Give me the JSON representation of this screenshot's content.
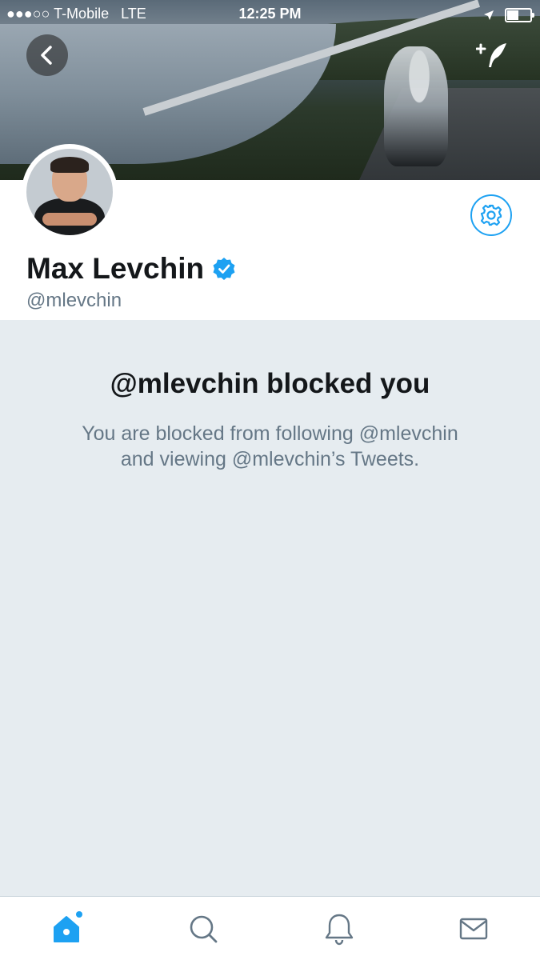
{
  "status_bar": {
    "signal": "●●●○○",
    "carrier": "T-Mobile",
    "network": "LTE",
    "time": "12:25 PM"
  },
  "profile": {
    "display_name": "Max Levchin",
    "handle": "@mlevchin",
    "verified": true
  },
  "blocked": {
    "title": "@mlevchin blocked you",
    "line1": "You are blocked from following @mlevchin",
    "line2": "and viewing @mlevchin’s Tweets."
  },
  "tab_bar": {
    "tabs": [
      {
        "icon": "home-icon",
        "active": true,
        "has_dot": true
      },
      {
        "icon": "search-icon",
        "active": false
      },
      {
        "icon": "notifications-icon",
        "active": false
      },
      {
        "icon": "messages-icon",
        "active": false
      }
    ]
  },
  "colors": {
    "accent": "#1da1f2",
    "background": "#e6ecf0",
    "text_primary": "#14171a",
    "text_secondary": "#657786"
  }
}
